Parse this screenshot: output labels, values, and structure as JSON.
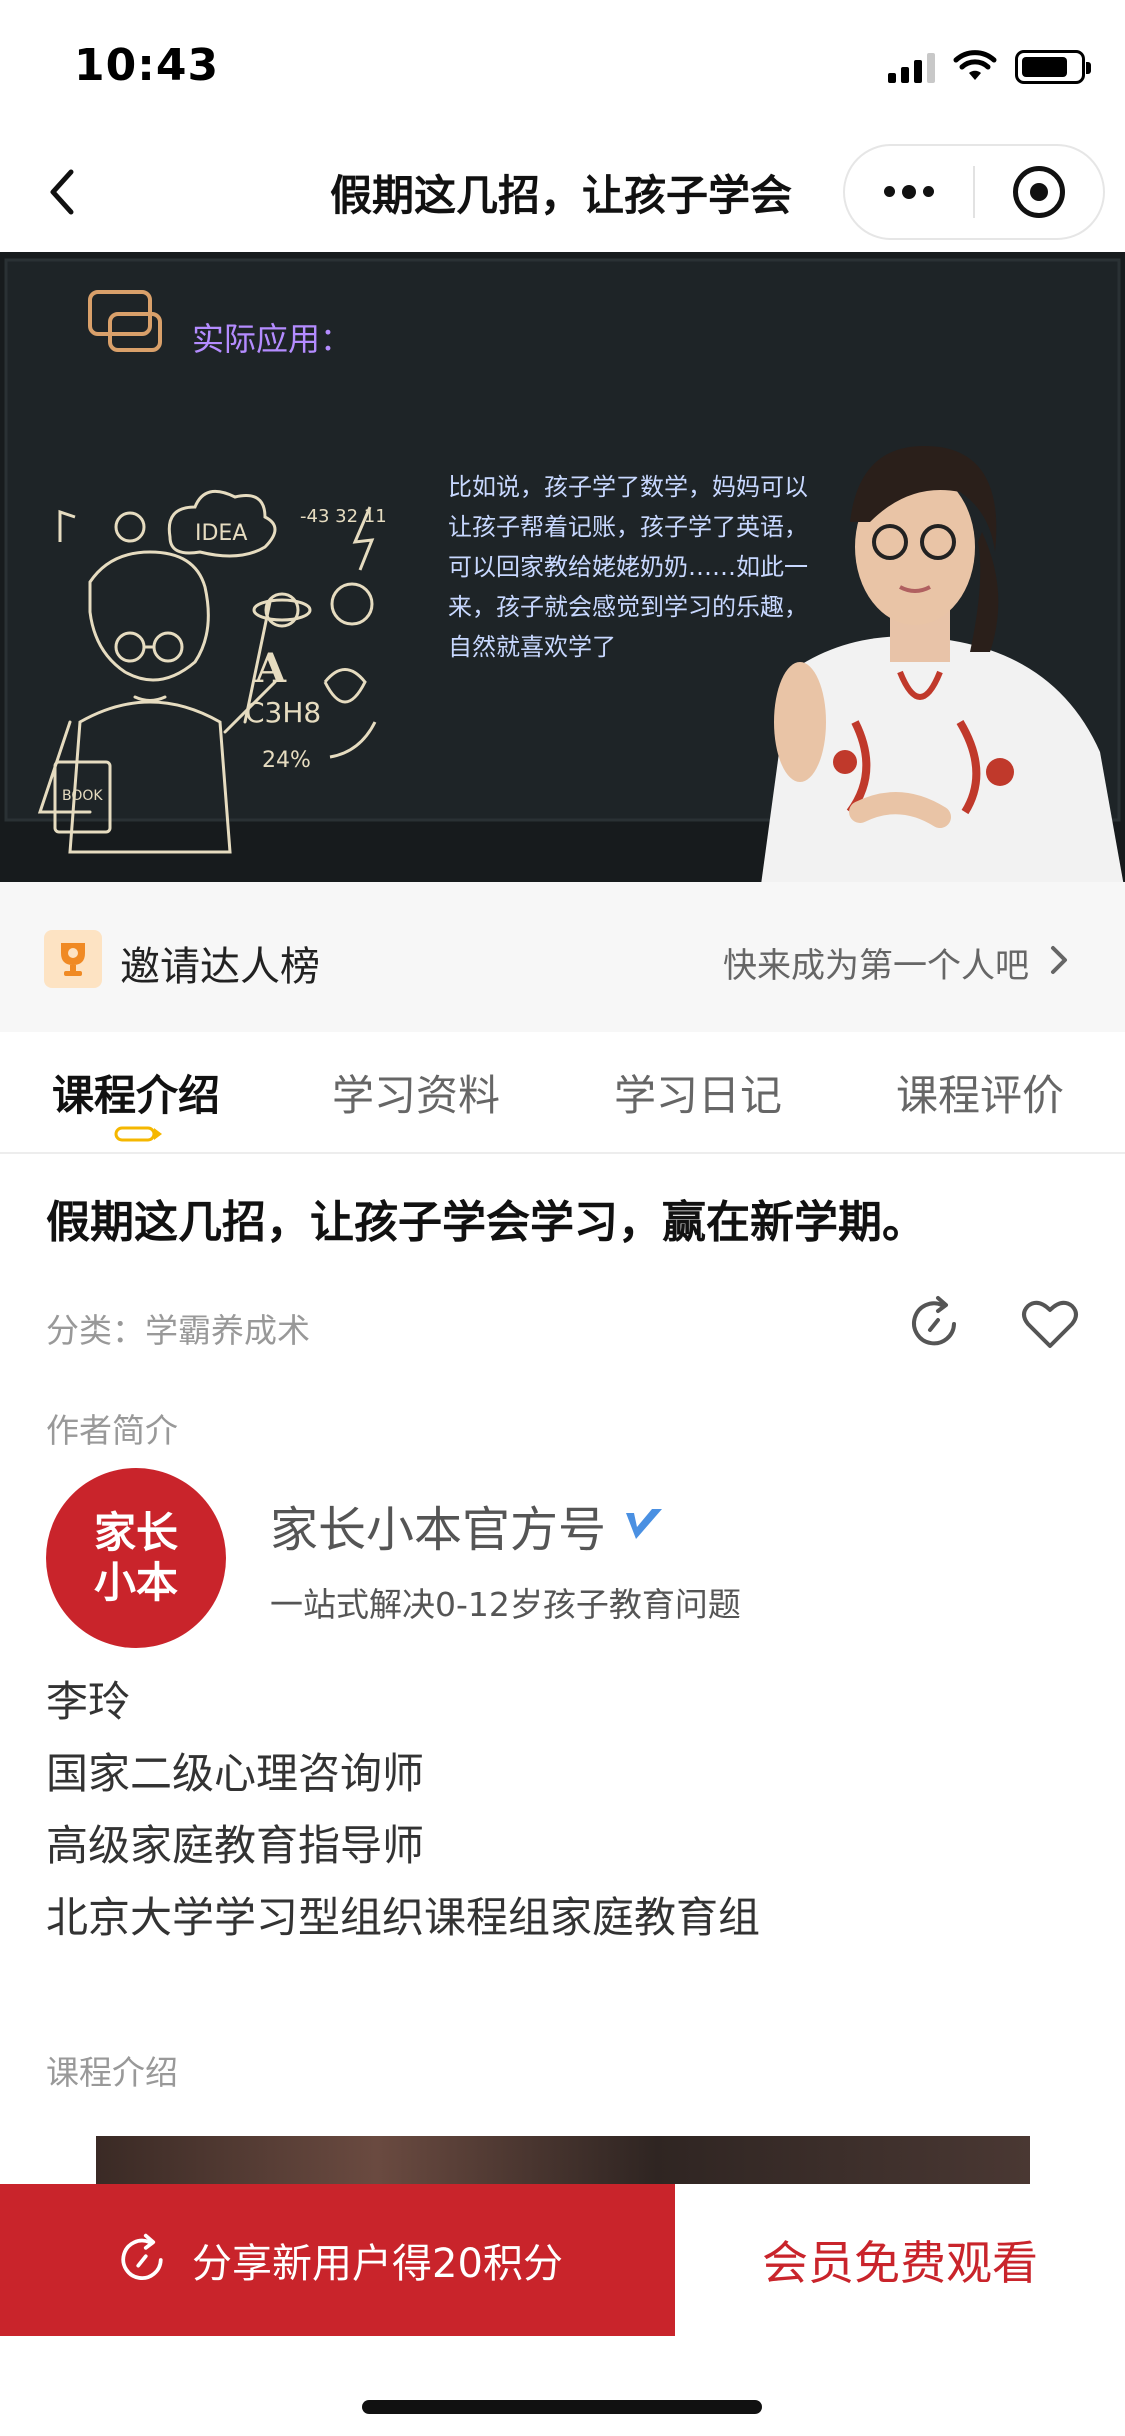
{
  "status_bar": {
    "time": "10:43"
  },
  "nav": {
    "title": "假期这几招，让孩子学会"
  },
  "video": {
    "board_title": "实际应用：",
    "board_text": "比如说，孩子学了数学，妈妈可以让孩子帮着记账，孩子学了英语，可以回家教给姥姥奶奶……如此一来，孩子就会感觉到学习的乐趣，自然就喜欢学了",
    "chalk_labels": {
      "idea": "IDEA",
      "numbers": "-43 32 11",
      "letter": "A",
      "formula": "C3H8",
      "percent": "24%",
      "book": "BOOK"
    }
  },
  "invite": {
    "label": "邀请达人榜",
    "cta": "快来成为第一个人吧"
  },
  "tabs": [
    {
      "label": "课程介绍",
      "active": true
    },
    {
      "label": "学习资料",
      "active": false
    },
    {
      "label": "学习日记",
      "active": false
    },
    {
      "label": "课程评价",
      "active": false
    }
  ],
  "course": {
    "title": "假期这几招，让孩子学会学习，赢在新学期。",
    "category": "分类：学霸养成术"
  },
  "author_section": {
    "label": "作者简介"
  },
  "author": {
    "avatar_line1": "家长",
    "avatar_line2": "小本",
    "name": "家长小本官方号",
    "description": "一站式解决0-12岁孩子教育问题"
  },
  "bio": [
    "李玲",
    "国家二级心理咨询师",
    "高级家庭教育指导师",
    "北京大学学习型组织课程组家庭教育组"
  ],
  "intro_section": {
    "label": "课程介绍"
  },
  "actions": {
    "share_label": "分享新用户得20积分",
    "member_label": "会员免费观看"
  },
  "colors": {
    "accent": "#c9242b",
    "verified": "#4a90e2",
    "tab_indicator": "#f5b700"
  },
  "icons": [
    "back-icon",
    "more-dots-icon",
    "close-target-icon",
    "trophy-icon",
    "chevron-right-icon",
    "share-refresh-icon",
    "heart-icon",
    "verified-icon"
  ]
}
